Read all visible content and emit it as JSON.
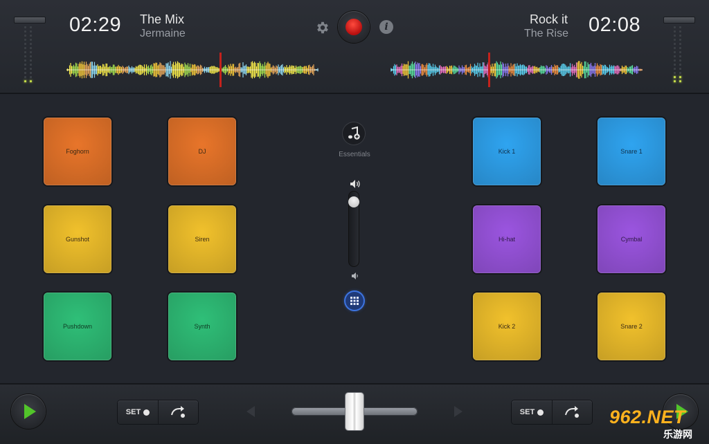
{
  "deck_left": {
    "time": "02:29",
    "title": "The Mix",
    "artist": "Jermaine"
  },
  "deck_right": {
    "time": "02:08",
    "title": "Rock it",
    "artist": "The Rise"
  },
  "icons": {
    "settings": "gear-icon",
    "record": "record-icon",
    "info": "info-icon",
    "essentials": "music-note-plus-icon",
    "volume_high": "speaker-loud-icon",
    "volume_low": "speaker-quiet-icon",
    "grid": "grid-icon",
    "play": "play-icon",
    "loop": "loop-arrow-icon",
    "nudge_left": "triangle-left-icon",
    "nudge_right": "triangle-right-icon"
  },
  "pads_left": [
    {
      "label": "Foghorn",
      "color": "#e8752a"
    },
    {
      "label": "DJ",
      "color": "#e8752a"
    },
    {
      "label": "Gunshot",
      "color": "#f1c12c"
    },
    {
      "label": "Siren",
      "color": "#f1c12c"
    },
    {
      "label": "Pushdown",
      "color": "#2fbf78"
    },
    {
      "label": "Synth",
      "color": "#2fbf78"
    }
  ],
  "pads_right": [
    {
      "label": "Kick 1",
      "color": "#2fa4f0"
    },
    {
      "label": "Snare 1",
      "color": "#2fa4f0"
    },
    {
      "label": "Hi-hat",
      "color": "#9b55e0"
    },
    {
      "label": "Cymbal",
      "color": "#9b55e0"
    },
    {
      "label": "Kick 2",
      "color": "#f1c12c"
    },
    {
      "label": "Snare 2",
      "color": "#f1c12c"
    }
  ],
  "center": {
    "essentials_label": "Essentials",
    "volume_level": 0.92
  },
  "footer": {
    "set_label_left": "SET",
    "set_label_right": "SET",
    "crossfader_position": 0.5
  },
  "watermark": {
    "brand": "962.NET",
    "subtitle": "乐游网"
  },
  "colors": {
    "accent_record": "#e0261e",
    "accent_play": "#52c52a",
    "accent_grid": "#3d74e0",
    "meter_lit": "#c8e04a"
  }
}
